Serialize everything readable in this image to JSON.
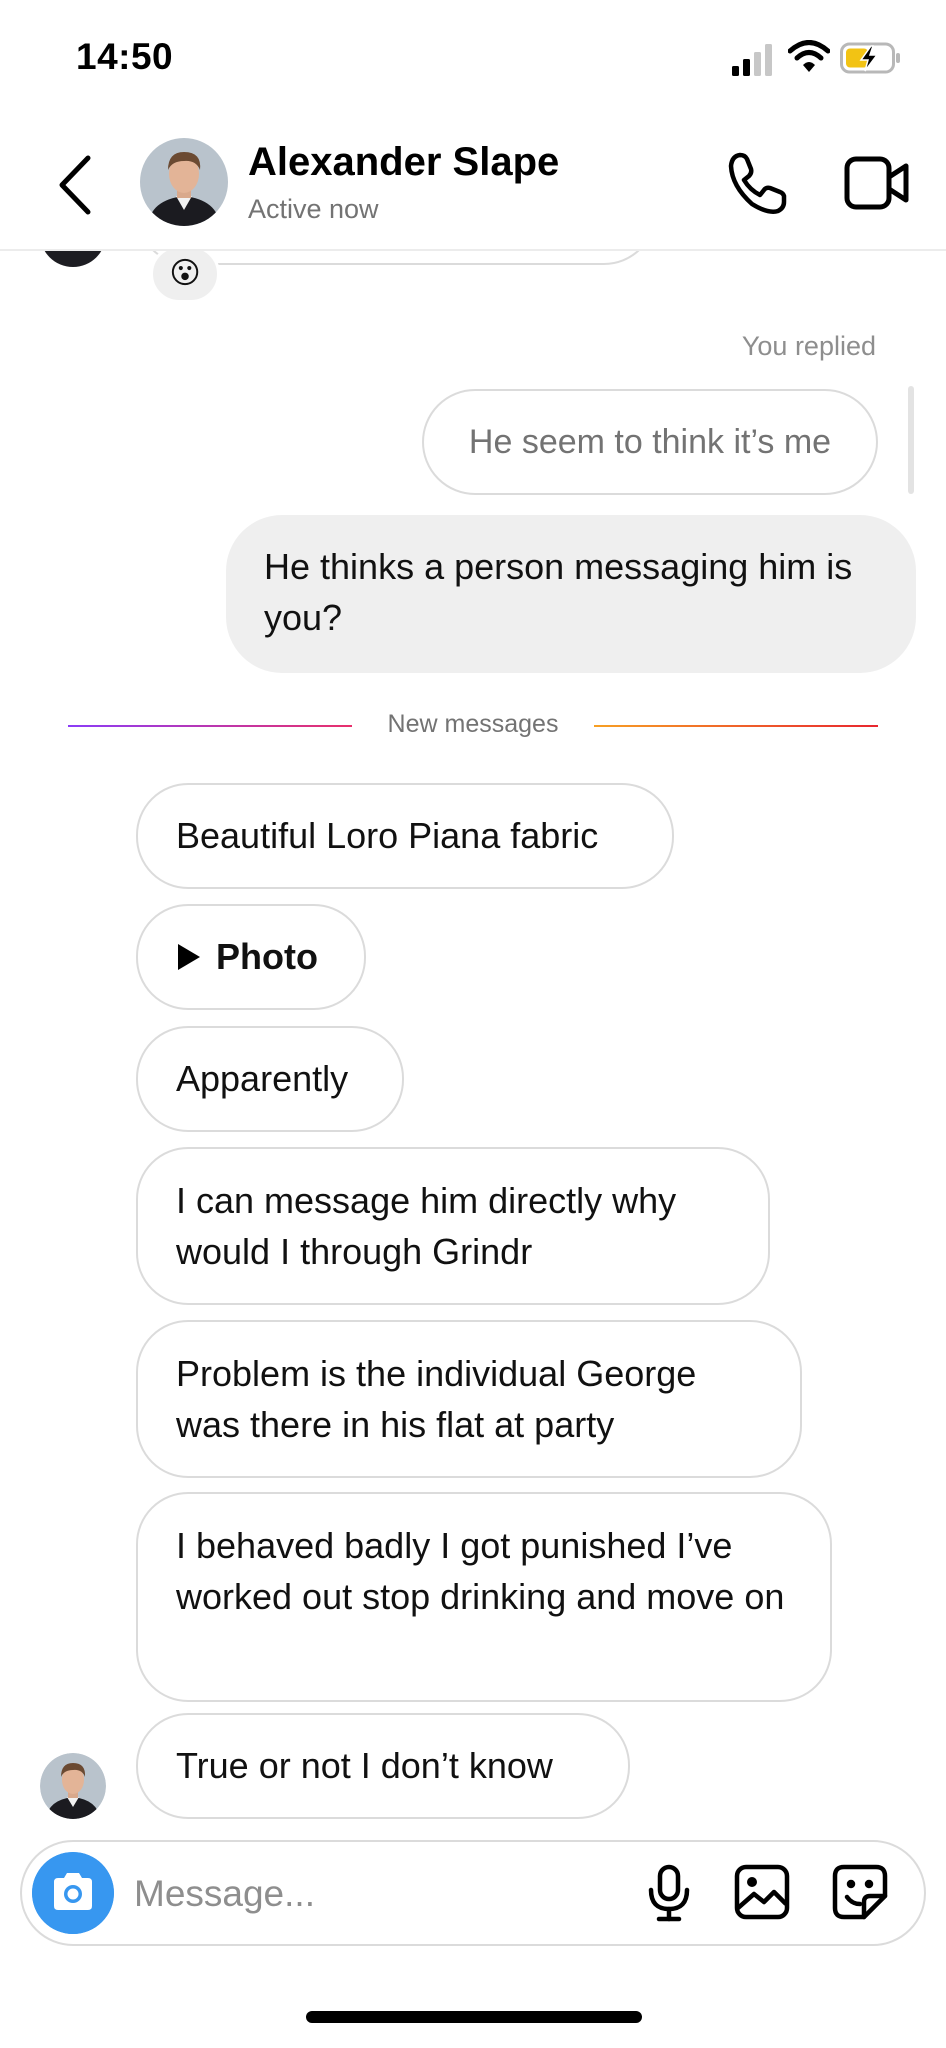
{
  "status_bar": {
    "time": "14:50"
  },
  "header": {
    "contact_name": "Alexander Slape",
    "contact_status": "Active now"
  },
  "thread": {
    "top_reaction": "😮",
    "reply_label": "You replied",
    "quoted_message": "He seem to think it’s me",
    "sent_message": "He thinks a person messaging him is you?",
    "new_messages_label": "New messages",
    "received_messages": [
      "Beautiful Loro Piana fabric",
      "Photo",
      "Apparently",
      "I can message him directly why would I through Grindr",
      "Problem is the individual George was there in his flat at party",
      "I behaved badly I got punished I’ve worked out stop drinking and move on",
      "True or not I don’t know"
    ]
  },
  "composer": {
    "placeholder": "Message..."
  },
  "icons": {
    "back": "chevron-left-icon",
    "call": "phone-icon",
    "video": "video-camera-icon",
    "camera": "camera-icon",
    "mic": "microphone-icon",
    "gallery": "image-icon",
    "sticker": "sticker-icon",
    "photo_play": "play-icon"
  },
  "colors": {
    "accent_blue": "#3797f0",
    "bubble_grey": "#efefef",
    "border": "#dbdbdb",
    "secondary_text": "#737373",
    "gradient_left": [
      "#8b3cf7",
      "#e8306c"
    ],
    "gradient_right": [
      "#f7a024",
      "#e8262f"
    ]
  }
}
